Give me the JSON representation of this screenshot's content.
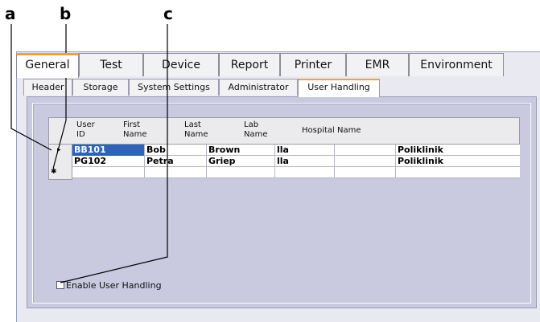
{
  "callouts": {
    "a": "a",
    "b": "b",
    "c": "c"
  },
  "main_tabs": [
    "General",
    "Test",
    "Device",
    "Report",
    "Printer",
    "EMR",
    "Environment"
  ],
  "main_tab_active": "General",
  "sub_tabs": [
    "Header",
    "Storage",
    "System Settings",
    "Administrator",
    "User Handling"
  ],
  "sub_tab_active": "User Handling",
  "grid": {
    "headers": [
      {
        "line1": "User",
        "line2": "ID"
      },
      {
        "line1": "First",
        "line2": "Name"
      },
      {
        "line1": "Last",
        "line2": "Name"
      },
      {
        "line1": "Lab",
        "line2": "Name"
      },
      {
        "line1": "Hospital Name",
        "line2": ""
      }
    ],
    "rows": [
      [
        "BB101",
        "Bob",
        "Brown",
        "lla",
        "",
        "Poliklinik"
      ],
      [
        "PG102",
        "Petra",
        "Griep",
        "lla",
        "",
        "Poliklinik"
      ],
      [
        "",
        "",
        "",
        "",
        "",
        ""
      ]
    ],
    "current_row_marker": "▸",
    "new_row_marker": "✱"
  },
  "enable_user_handling": {
    "label": "Enable User Handling",
    "checked": false
  },
  "colors": {
    "accent_tab": "#f2a03d",
    "selection": "#2e63b8",
    "panel": "#c9c9e0"
  }
}
